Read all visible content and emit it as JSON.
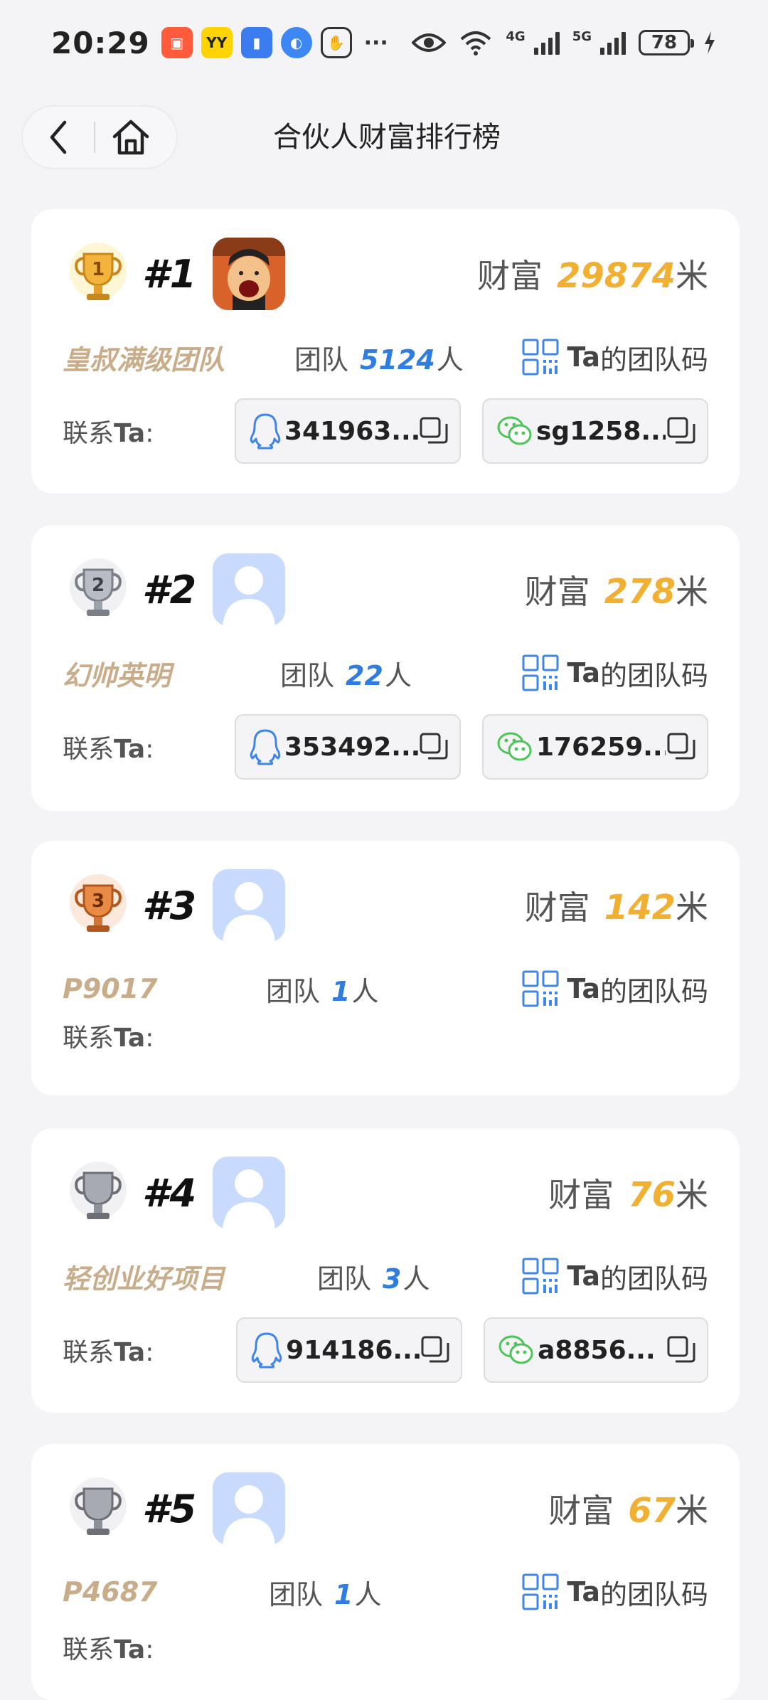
{
  "status": {
    "time": "20:29",
    "battery": "78",
    "net1": "4G",
    "net2": "5G"
  },
  "header": {
    "title": "合伙人财富排行榜"
  },
  "labels": {
    "wealth": "财富",
    "wealth_unit": "米",
    "team": "团队",
    "team_unit": "人",
    "qrcode_ta": "Ta",
    "qrcode_rest": "的团队码",
    "contact_prefix": "联系",
    "contact_ta": "Ta",
    "contact_colon": ":"
  },
  "entries": [
    {
      "rank": "#1",
      "name": "皇叔满级团队",
      "wealth": "29874",
      "team": "5124",
      "qq": "341963...",
      "wechat": "sg1258...",
      "trophy": "gold"
    },
    {
      "rank": "#2",
      "name": "幻帅英明",
      "wealth": "278",
      "team": "22",
      "qq": "353492...",
      "wechat": "176259...",
      "trophy": "silver"
    },
    {
      "rank": "#3",
      "name": "P9017",
      "wealth": "142",
      "team": "1",
      "qq": "",
      "wechat": "",
      "trophy": "bronze"
    },
    {
      "rank": "#4",
      "name": "轻创业好项目",
      "wealth": "76",
      "team": "3",
      "qq": "914186...",
      "wechat": "a8856...",
      "trophy": "grey"
    },
    {
      "rank": "#5",
      "name": "P4687",
      "wealth": "67",
      "team": "1",
      "qq": "",
      "wechat": "",
      "trophy": "grey"
    }
  ],
  "colors": {
    "wealth": "#f1b032",
    "team_count": "#2f7de0",
    "team_name": "#c9ad8a",
    "avatar_bg": "#c8dbff"
  }
}
